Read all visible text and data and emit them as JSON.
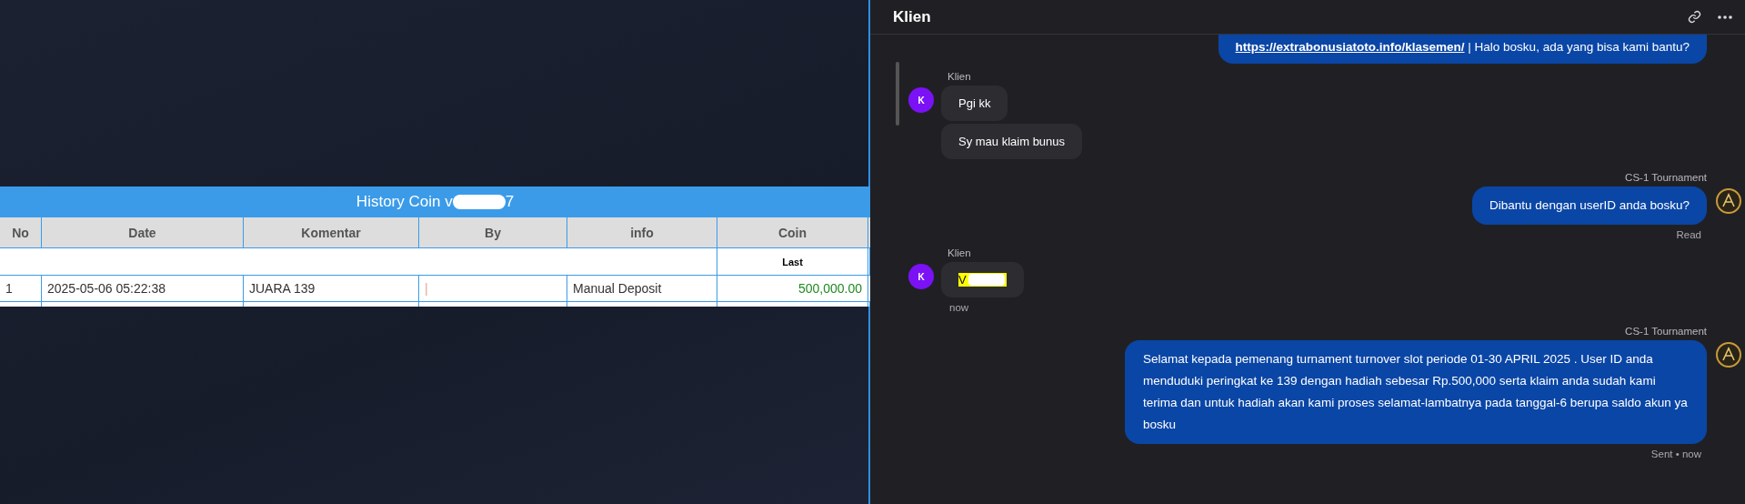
{
  "history": {
    "title": "History Coin v",
    "title_end": "7",
    "columns": [
      "No",
      "Date",
      "Komentar",
      "By",
      "info",
      "Coin"
    ],
    "subheader": "Last",
    "rows": [
      {
        "no": "1",
        "date": "2025-05-06 05:22:38",
        "komentar": "JUARA 139",
        "by": "|",
        "info": "Manual Deposit",
        "coin": "500,000.00"
      }
    ]
  },
  "chat": {
    "title": "Klien",
    "messages": [
      {
        "kind": "outgoing",
        "link": "https://extrabonusiatoto.info/klasemen/",
        "text": " | Halo bosku, ada yang bisa kami bantu?"
      },
      {
        "kind": "incoming",
        "sender": "Klien",
        "avatar": "K",
        "bubbles": [
          {
            "text": "Pgi kk"
          },
          {
            "text": "Sy mau klaim bunus"
          }
        ]
      },
      {
        "kind": "outgoing",
        "sender": "CS-1 Tournament",
        "text": "Dibantu dengan userID anda bosku?",
        "status": "Read"
      },
      {
        "kind": "incoming",
        "sender": "Klien",
        "avatar": "K",
        "bubbles": [
          {
            "text": "V",
            "highlight": true
          }
        ],
        "status": "now"
      },
      {
        "kind": "outgoing",
        "sender": "CS-1 Tournament",
        "text": "Selamat kepada pemenang turnament turnover slot periode 01-30 APRIL 2025 . User ID anda menduduki peringkat ke 139 dengan hadiah sebesar Rp.500,000 serta klaim anda sudah kami terima dan untuk hadiah akan kami proses selamat-lambatnya pada tanggal-6 berupa saldo akun ya bosku",
        "status": "Sent • now"
      }
    ]
  }
}
